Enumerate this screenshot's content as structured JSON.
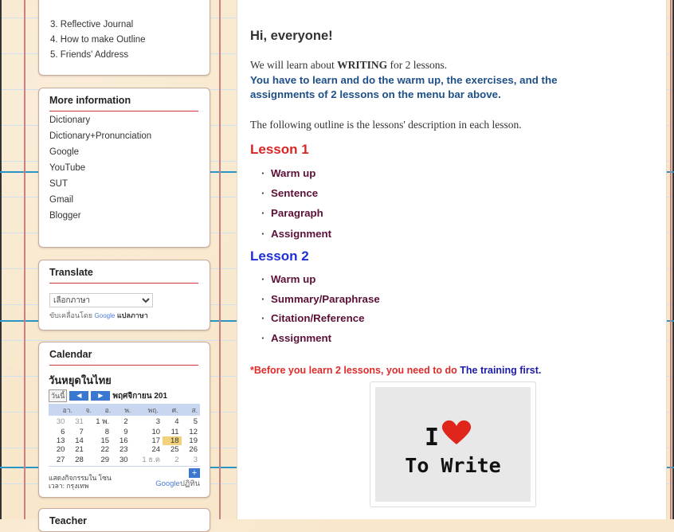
{
  "sidebar": {
    "top_links": [
      "3. Reflective Journal",
      "4. How to make Outline",
      "5. Friends' Address"
    ],
    "more_info": {
      "title": "More information",
      "links": [
        "Dictionary",
        "Dictionary+Pronunciation",
        "Google",
        "YouTube",
        "SUT",
        "Gmail",
        "Blogger"
      ]
    },
    "translate": {
      "title": "Translate",
      "select_value": "เลือกภาษา",
      "powered_by": "ขับเคลื่อนโดย",
      "google": "Google",
      "translate_label": "แปลภาษา"
    },
    "calendar": {
      "title": "Calendar",
      "cal_name": "วันหยุดในไทย",
      "today_btn": "วันนี้",
      "month_label": "พฤศจิกายน 201",
      "weekdays": [
        "อา.",
        "จ.",
        "อ.",
        "พ.",
        "พฤ.",
        "ศ.",
        "ส."
      ],
      "weeks": [
        [
          "30",
          "31",
          "1 พ.",
          "2",
          "3",
          "4",
          "5"
        ],
        [
          "6",
          "7",
          "8",
          "9",
          "10",
          "11",
          "12"
        ],
        [
          "13",
          "14",
          "15",
          "16",
          "17",
          "18",
          "19"
        ],
        [
          "20",
          "21",
          "22",
          "23",
          "24",
          "25",
          "26"
        ],
        [
          "27",
          "28",
          "29",
          "30",
          "1 ธ.ค",
          "2",
          "3"
        ]
      ],
      "timezone_label": "แสดงกิจกรรมใน โซนเวลา: กรุงเทพ",
      "google_calendar": "Google",
      "calendar_word": "ปฏิทิน"
    },
    "next_widget_title": "Teacher"
  },
  "main": {
    "greeting": "Hi, everyone!",
    "intro_pre": "We will learn about ",
    "intro_bold": "WRITING",
    "intro_post": " for 2 lessons.",
    "instructions_line1": "You have to learn and do the warm up, the exercises, and the",
    "instructions_line2": "assignments of 2 lessons on the menu bar above.",
    "outline_text": "The following outline is the lessons' description in each lesson.",
    "lessons": [
      {
        "title": "Lesson 1",
        "color": "#d72626",
        "items": [
          "Warm up",
          "Sentence",
          "Paragraph",
          "Assignment"
        ]
      },
      {
        "title": "Lesson 2",
        "color": "#1e2fd6",
        "items": [
          "Warm up",
          "Summary/Paraphrase",
          "Citation/Reference",
          "Assignment"
        ]
      }
    ],
    "before_text": "*Before you learn 2 lessons, you need to do ",
    "training_link": "The training first.",
    "image_text_top": "I",
    "image_text_bottom": "To Write"
  },
  "colors": {
    "page_bg": "#f8e7cb",
    "lesson1": "#d72626",
    "lesson2": "#1e2fd6",
    "instructions": "#1e4f87",
    "bullet_items": "#5b1037",
    "calendar_header": "#3a77d0",
    "today_cell": "#f1d27a"
  }
}
